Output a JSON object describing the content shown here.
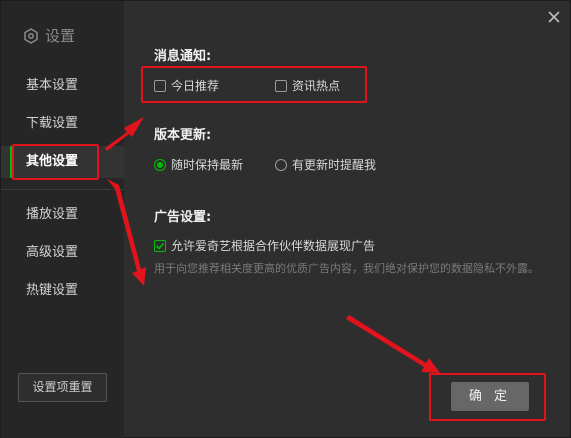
{
  "sidebar": {
    "title": "设置",
    "items": [
      {
        "label": "基本设置"
      },
      {
        "label": "下载设置"
      },
      {
        "label": "其他设置"
      },
      {
        "label": "播放设置"
      },
      {
        "label": "高级设置"
      },
      {
        "label": "热键设置"
      }
    ],
    "reset_label": "设置项重置"
  },
  "notify": {
    "title": "消息通知:",
    "options": [
      {
        "label": "今日推荐",
        "checked": false
      },
      {
        "label": "资讯热点",
        "checked": false
      }
    ]
  },
  "update": {
    "title": "版本更新:",
    "options": [
      {
        "label": "随时保持最新",
        "selected": true
      },
      {
        "label": "有更新时提醒我",
        "selected": false
      }
    ]
  },
  "ads": {
    "title": "广告设置:",
    "option_label": "允许爱奇艺根据合作伙伴数据展现广告",
    "option_checked": true,
    "description": "用于向您推荐相关度更高的优质广告内容，我们绝对保护您的数据隐私不外露。"
  },
  "footer": {
    "confirm_label": "确 定"
  },
  "colors": {
    "accent": "#00be06",
    "annotation": "#e1131d"
  },
  "icons": {
    "title": "settings-hex-icon",
    "close": "close-icon",
    "check": "check-icon"
  }
}
